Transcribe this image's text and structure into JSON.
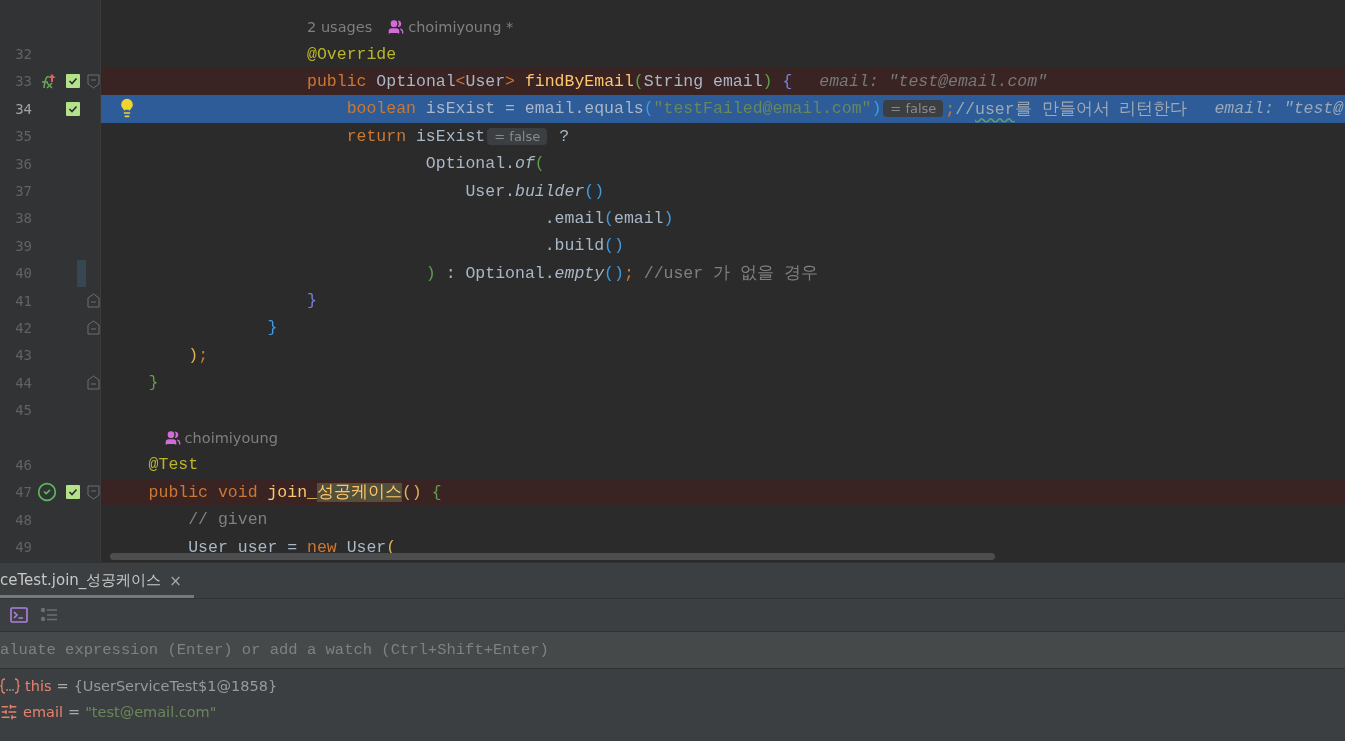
{
  "editor": {
    "lines": [
      {
        "kind": "inlay",
        "usages": "2 usages",
        "author": "choimiyoung *"
      },
      {
        "kind": "code",
        "number": "32",
        "execution_point": false,
        "error_highlight": false,
        "changed": false,
        "bulb": false,
        "tokens": [
          {
            "kind": "ann",
            "text": "                    @Override"
          }
        ]
      },
      {
        "kind": "code",
        "number": "33",
        "execution_point": false,
        "error_highlight": true,
        "changed": false,
        "bulb": false,
        "gutter_icons": [
          {
            "kind": "fx"
          },
          {
            "kind": "check"
          },
          {
            "kind": "fold-start"
          }
        ],
        "tokens": [
          {
            "kind": "kw",
            "text": "                    public"
          },
          {
            "kind": "pl",
            "text": " Optional"
          },
          {
            "kind": "kw",
            "text": "<"
          },
          {
            "kind": "pl",
            "text": "User"
          },
          {
            "kind": "kw",
            "text": ">"
          },
          {
            "kind": "fn",
            "text": " findByEmail"
          },
          {
            "kind": "pg",
            "text": "("
          },
          {
            "kind": "pl",
            "text": "String email"
          },
          {
            "kind": "pg",
            "text": ")"
          },
          {
            "kind": "pp",
            "text": " {"
          },
          {
            "kind": "hint",
            "text": "email: \"test@email.com\""
          }
        ]
      },
      {
        "kind": "code",
        "number": "34",
        "execution_point": true,
        "error_highlight": false,
        "changed": false,
        "bulb": true,
        "gutter_icons": [
          {
            "kind": "check"
          }
        ],
        "tokens": [
          {
            "kind": "kw",
            "text": "                        boolean"
          },
          {
            "kind": "pl",
            "text": " isExist = email.equals"
          },
          {
            "kind": "pb",
            "text": "("
          },
          {
            "kind": "str",
            "text": "\"testFailed@email.com\""
          },
          {
            "kind": "pb",
            "text": ")"
          },
          {
            "kind": "pill",
            "text": "= false"
          },
          {
            "kind": "kw",
            "text": ";"
          },
          {
            "kind": "cm",
            "text": "//"
          },
          {
            "kind": "typo",
            "text": "user"
          },
          {
            "kind": "cm",
            "text": "를 만들어서 리턴한다"
          },
          {
            "kind": "hint",
            "text": "email: \"test@"
          }
        ]
      },
      {
        "kind": "code",
        "number": "35",
        "execution_point": false,
        "error_highlight": false,
        "changed": false,
        "bulb": false,
        "tokens": [
          {
            "kind": "kw",
            "text": "                        return"
          },
          {
            "kind": "pl",
            "text": " isExist"
          },
          {
            "kind": "pill",
            "text": "= false"
          },
          {
            "kind": "pl",
            "text": " ?"
          }
        ]
      },
      {
        "kind": "code",
        "number": "36",
        "execution_point": false,
        "error_highlight": false,
        "changed": false,
        "bulb": false,
        "tokens": [
          {
            "kind": "pl",
            "text": "                                Optional."
          },
          {
            "kind": "it",
            "text": "of"
          },
          {
            "kind": "pg",
            "text": "("
          }
        ]
      },
      {
        "kind": "code",
        "number": "37",
        "execution_point": false,
        "error_highlight": false,
        "changed": false,
        "bulb": false,
        "tokens": [
          {
            "kind": "pl",
            "text": "                                    User."
          },
          {
            "kind": "it",
            "text": "builder"
          },
          {
            "kind": "pb",
            "text": "()"
          }
        ]
      },
      {
        "kind": "code",
        "number": "38",
        "execution_point": false,
        "error_highlight": false,
        "changed": false,
        "bulb": false,
        "tokens": [
          {
            "kind": "pl",
            "text": "                                            .email"
          },
          {
            "kind": "pb",
            "text": "("
          },
          {
            "kind": "pl",
            "text": "email"
          },
          {
            "kind": "pb",
            "text": ")"
          }
        ]
      },
      {
        "kind": "code",
        "number": "39",
        "execution_point": false,
        "error_highlight": false,
        "changed": false,
        "bulb": false,
        "tokens": [
          {
            "kind": "pl",
            "text": "                                            .build"
          },
          {
            "kind": "pb",
            "text": "()"
          }
        ]
      },
      {
        "kind": "code",
        "number": "40",
        "execution_point": false,
        "error_highlight": false,
        "changed": true,
        "bulb": false,
        "tokens": [
          {
            "kind": "pg",
            "text": "                                )"
          },
          {
            "kind": "pl",
            "text": " : Optional."
          },
          {
            "kind": "it",
            "text": "empty"
          },
          {
            "kind": "pb",
            "text": "()"
          },
          {
            "kind": "kw",
            "text": ";"
          },
          {
            "kind": "cm",
            "text": " //user 가 없을 경우"
          }
        ]
      },
      {
        "kind": "code",
        "number": "41",
        "execution_point": false,
        "error_highlight": false,
        "changed": false,
        "bulb": false,
        "gutter_icons": [
          {
            "kind": "fold-end"
          }
        ],
        "tokens": [
          {
            "kind": "pp",
            "text": "                    }"
          }
        ]
      },
      {
        "kind": "code",
        "number": "42",
        "execution_point": false,
        "error_highlight": false,
        "changed": false,
        "bulb": false,
        "gutter_icons": [
          {
            "kind": "fold-end"
          }
        ],
        "tokens": [
          {
            "kind": "pb",
            "text": "                }"
          }
        ]
      },
      {
        "kind": "code",
        "number": "43",
        "execution_point": false,
        "error_highlight": false,
        "changed": false,
        "bulb": false,
        "tokens": [
          {
            "kind": "py",
            "text": "        )"
          },
          {
            "kind": "kw",
            "text": ";"
          }
        ]
      },
      {
        "kind": "code",
        "number": "44",
        "execution_point": false,
        "error_highlight": false,
        "changed": false,
        "bulb": false,
        "gutter_icons": [
          {
            "kind": "fold-end"
          }
        ],
        "tokens": [
          {
            "kind": "pg",
            "text": "    }"
          }
        ]
      },
      {
        "kind": "code",
        "number": "45",
        "execution_point": false,
        "error_highlight": false,
        "changed": false,
        "bulb": false
      },
      {
        "kind": "inlay",
        "author": "choimiyoung"
      },
      {
        "kind": "code",
        "number": "46",
        "execution_point": false,
        "error_highlight": false,
        "changed": false,
        "bulb": false,
        "tokens": [
          {
            "kind": "ann",
            "text": "    @Test"
          }
        ]
      },
      {
        "kind": "code",
        "number": "47",
        "execution_point": false,
        "error_highlight": true,
        "changed": false,
        "bulb": false,
        "gutter_icons": [
          {
            "kind": "passed"
          },
          {
            "kind": "check"
          },
          {
            "kind": "fold-start"
          }
        ],
        "tokens": [
          {
            "kind": "kw",
            "text": "    public void"
          },
          {
            "kind": "fn",
            "text": " join_"
          },
          {
            "kind": "match",
            "text": "성공케이스"
          },
          {
            "kind": "py",
            "text": "()"
          },
          {
            "kind": "pg",
            "text": " {"
          }
        ]
      },
      {
        "kind": "code",
        "number": "48",
        "execution_point": false,
        "error_highlight": false,
        "changed": false,
        "bulb": false,
        "tokens": [
          {
            "kind": "cm",
            "text": "        // given"
          }
        ]
      },
      {
        "kind": "code",
        "number": "49",
        "execution_point": false,
        "error_highlight": false,
        "changed": false,
        "bulb": false,
        "tokens": [
          {
            "kind": "pl",
            "text": "        User user = "
          },
          {
            "kind": "kw",
            "text": "new"
          },
          {
            "kind": "pl",
            "text": " User"
          },
          {
            "kind": "py",
            "text": "("
          }
        ]
      }
    ]
  },
  "debug_panel": {
    "tabs": [
      {
        "label": "ceTest.join_성공케이스",
        "selected": true,
        "close": "×"
      }
    ],
    "evaluate": {
      "placeholder": "aluate expression (Enter) or add a watch (Ctrl+Shift+Enter)"
    },
    "variables": [
      {
        "kind": "object",
        "name": "this",
        "equals": "=",
        "value": "{UserServiceTest$1@1858}"
      },
      {
        "kind": "field",
        "name": "email",
        "equals": "=",
        "value": "\"test@email.com\""
      }
    ]
  }
}
